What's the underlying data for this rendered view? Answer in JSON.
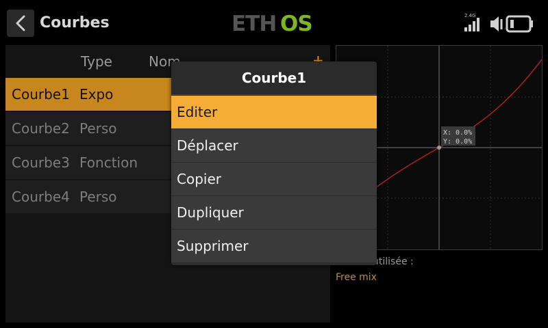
{
  "header": {
    "title": "Courbes",
    "logo": "ETHOS",
    "radio_label": "2.4G"
  },
  "list": {
    "columns": [
      "Type",
      "Nom"
    ],
    "add_symbol": "+",
    "rows": [
      {
        "name": "Courbe1",
        "type": "Expo"
      },
      {
        "name": "Courbe2",
        "type": "Perso"
      },
      {
        "name": "Courbe3",
        "type": "Fonction"
      },
      {
        "name": "Courbe4",
        "type": "Perso"
      }
    ]
  },
  "chart": {
    "cursor_x": "X: 0.0%",
    "cursor_y": "Y: 0.0%",
    "usage_label": "utilisée :",
    "usage_value": "Free mix"
  },
  "popup": {
    "title": "Courbe1",
    "items": [
      "Editer",
      "Déplacer",
      "Copier",
      "Dupliquer",
      "Supprimer"
    ]
  },
  "colors": {
    "accent": "#f5ad38",
    "selected_row": "#c8861e",
    "logo_green": "#7fb51f",
    "curve": "#b0201e"
  }
}
